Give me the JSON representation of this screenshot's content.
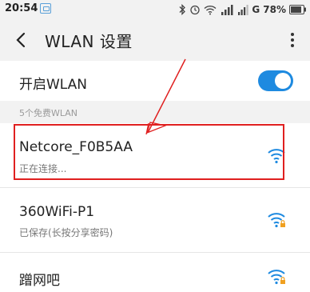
{
  "status_bar": {
    "time": "20:54",
    "network_type": "G",
    "battery_percent": "78%"
  },
  "app_bar": {
    "title": "WLAN 设置"
  },
  "wlan_toggle": {
    "label": "开启WLAN",
    "enabled": true
  },
  "section": {
    "header": "5个免费WLAN"
  },
  "networks": [
    {
      "name": "Netcore_F0B5AA",
      "status": "正在连接...",
      "locked": false
    },
    {
      "name": "360WiFi-P1",
      "status": "已保存(长按分享密码)",
      "locked": true
    },
    {
      "name": "蹭网吧",
      "status": "",
      "locked": true
    }
  ],
  "colors": {
    "accent": "#1e8ae0",
    "annotation_red": "#e02020",
    "background_gray": "#f2f2f2"
  }
}
